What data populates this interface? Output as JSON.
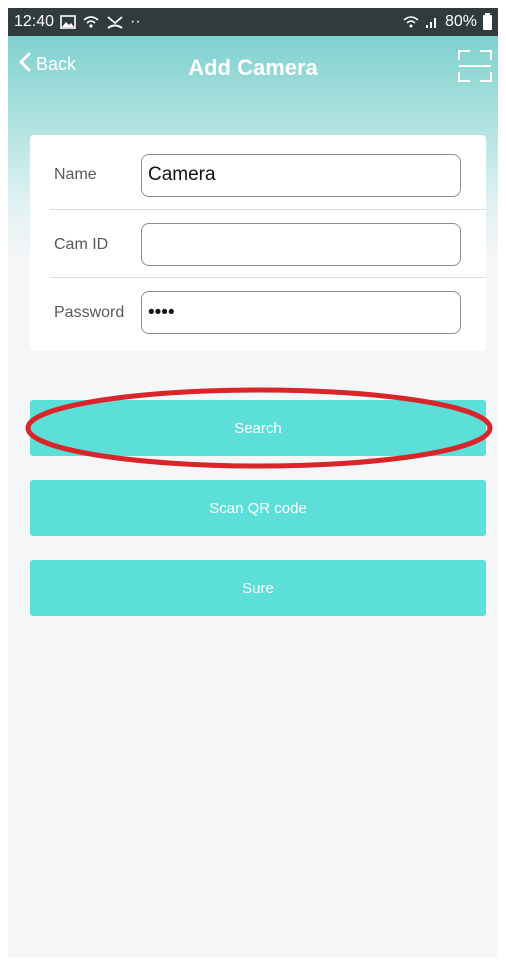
{
  "status_bar": {
    "time": "12:40",
    "extra_dots": "··",
    "battery": "80%"
  },
  "nav": {
    "back_label": "Back",
    "title": "Add Camera"
  },
  "form": {
    "name_label": "Name",
    "name_value": "Camera",
    "camid_label": "Cam ID",
    "camid_value": "",
    "password_label": "Password",
    "password_value": "1234"
  },
  "buttons": {
    "search": "Search",
    "scan_qr": "Scan QR code",
    "sure": "Sure"
  },
  "colors": {
    "accent": "#5cded9",
    "header_gradient_top": "#7fd1cf",
    "highlight_annotation": "#d9252a"
  }
}
